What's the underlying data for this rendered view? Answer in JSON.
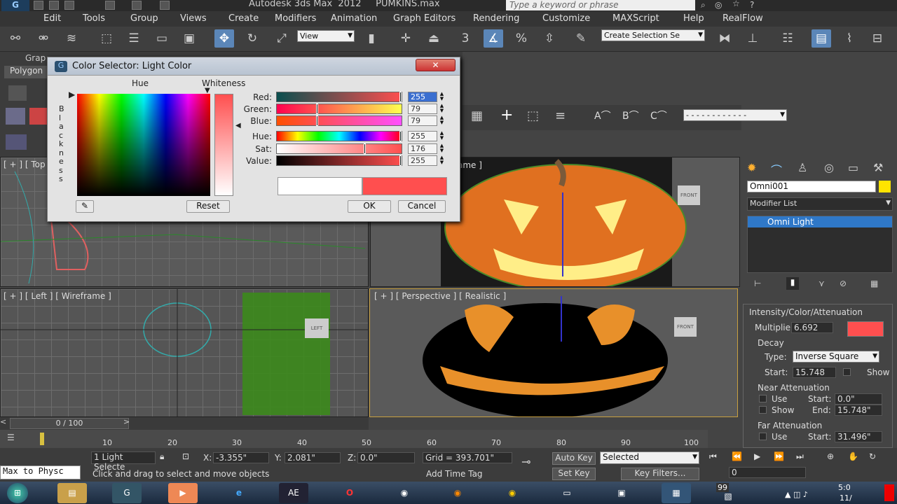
{
  "app": {
    "title": "Autodesk 3ds Max  2012     PUMKINS.max",
    "search_placeholder": "Type a keyword or phrase"
  },
  "menu": [
    "Edit",
    "Tools",
    "Group",
    "Views",
    "Create",
    "Modifiers",
    "Animation",
    "Graph Editors",
    "Rendering",
    "Customize",
    "MAXScript",
    "Help",
    "RealFlow"
  ],
  "toolbar": {
    "view_select": "View",
    "selection_set": "Create Selection Se",
    "snap_label": "3"
  },
  "ribbon": {
    "tab1": "Grap",
    "tab2": "Polygon"
  },
  "dialog": {
    "title": "Color Selector: Light Color",
    "hue_label": "Hue",
    "whiteness_label": "Whiteness",
    "blackness_label": "B l a c k n e s s",
    "channels": [
      {
        "label": "Red:",
        "value": "255",
        "fraction": 1.0
      },
      {
        "label": "Green:",
        "value": "79",
        "fraction": 0.31
      },
      {
        "label": "Blue:",
        "value": "79",
        "fraction": 0.31
      },
      {
        "label": "Hue:",
        "value": "255",
        "fraction": 1.0
      },
      {
        "label": "Sat:",
        "value": "176",
        "fraction": 0.69
      },
      {
        "label": "Value:",
        "value": "255",
        "fraction": 1.0
      }
    ],
    "reset": "Reset",
    "ok": "OK",
    "cancel": "Cancel",
    "old_color": "#ffffff",
    "new_color": "#ff4f4f"
  },
  "viewports": {
    "top": "[ + ] [ Top",
    "front_suffix": "ame ]",
    "left": "[ + ] [ Left ] [ Wireframe ]",
    "persp": "[ + ] [ Perspective ] [ Realistic ]",
    "cube_front": "FRONT",
    "cube_left": "LEFT",
    "cube_front2": "FRONT"
  },
  "command_panel": {
    "object_name": "Omni001",
    "modifier_list": "Modifier List",
    "stack_item": "Omni Light",
    "rollout_title": "Intensity/Color/Attenuation",
    "multiplier_label": "Multiplier:",
    "multiplier": "6.692",
    "decay_label": "Decay",
    "type_label": "Type:",
    "type_value": "Inverse Square",
    "start_label": "Start:",
    "decay_start": "15.748",
    "show_label": "Show",
    "near_label": "Near Attenuation",
    "use_label": "Use",
    "near_start": "0.0\"",
    "end_label": "End:",
    "near_end": "15.748\"",
    "far_label": "Far Attenuation",
    "far_start": "31.496\"",
    "swatch_color": "#ff4f4f"
  },
  "timeline": {
    "frame": "0 / 100",
    "ticks": [
      "10",
      "20",
      "30",
      "40",
      "50",
      "60",
      "70",
      "80",
      "90",
      "100"
    ]
  },
  "status": {
    "maxscript": "Max to Physc",
    "selected_count": "1 Light Selecte",
    "x_label": "X:",
    "x": "-3.355\"",
    "y_label": "Y:",
    "y": "2.081\"",
    "z_label": "Z:",
    "z": "0.0\"",
    "grid": "Grid = 393.701\"",
    "auto_key": "Auto Key",
    "key_mode": "Selected",
    "set_key": "Set Key",
    "key_filters": "Key Filters...",
    "frame_field": "0",
    "prompt": "Click and drag to select and move objects",
    "add_time_tag": "Add Time Tag"
  },
  "taskbar": {
    "clock": "5:0",
    "date": "11/",
    "ae": "AE",
    "badge": "99"
  }
}
